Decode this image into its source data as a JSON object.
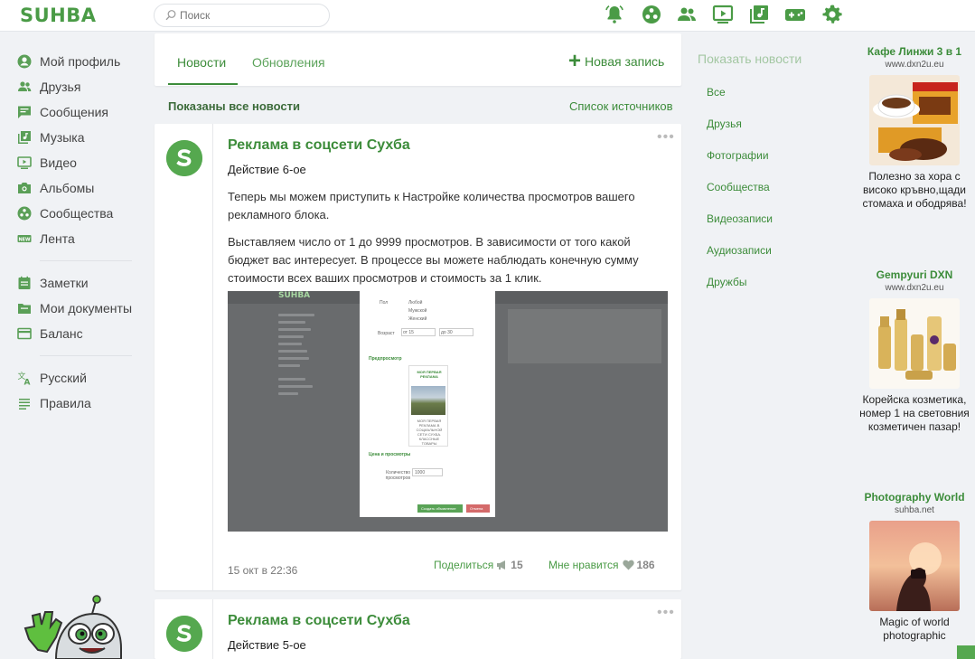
{
  "header": {
    "logo": "SUHBA",
    "search_placeholder": "Поиск",
    "icons": [
      "bell-icon",
      "communities-icon",
      "friends-icon",
      "video-icon",
      "music-icon",
      "games-icon",
      "settings-icon"
    ]
  },
  "sidebar": {
    "items": [
      {
        "label": "Мой профиль",
        "icon": "profile-icon"
      },
      {
        "label": "Друзья",
        "icon": "friends-icon"
      },
      {
        "label": "Сообщения",
        "icon": "messages-icon"
      },
      {
        "label": "Музыка",
        "icon": "music-icon"
      },
      {
        "label": "Видео",
        "icon": "video-icon"
      },
      {
        "label": "Альбомы",
        "icon": "camera-icon"
      },
      {
        "label": "Сообщества",
        "icon": "communities-icon"
      },
      {
        "label": "Лента",
        "icon": "new-badge-icon"
      }
    ],
    "items2": [
      {
        "label": "Заметки",
        "icon": "notes-icon"
      },
      {
        "label": "Мои документы",
        "icon": "documents-icon"
      },
      {
        "label": "Баланс",
        "icon": "card-icon"
      }
    ],
    "items3": [
      {
        "label": "Русский",
        "icon": "language-icon"
      },
      {
        "label": "Правила",
        "icon": "rules-icon"
      }
    ]
  },
  "tabs": {
    "news": "Новости",
    "updates": "Обновления",
    "new_post": "Новая запись"
  },
  "filter": {
    "shown": "Показаны все новости",
    "sources": "Список источников"
  },
  "posts": [
    {
      "title": "Реклама в соцсети Сухба",
      "subtitle": "Действие 6-ое",
      "paragraph1": "Теперь мы можем приступить к Настройке количества просмотров вашего рекламного блока.",
      "paragraph2": "Выставляем число от 1 до 9999 просмотров. В зависимости от того какой бюджет вас интересует. В процессе вы можете наблюдать конечную сумму стоимости всех ваших просмотров и стоимость за 1 клик.",
      "date": "15 окт в 22:36",
      "share_label": "Поделиться",
      "share_count": "15",
      "like_label": "Мне нравится",
      "like_count": "186",
      "image": {
        "logo": "SUHBA",
        "ad_title": "МОЯ ПЕРВАЯ РЕКЛАМА",
        "ad_caption": "МОЯ ПЕРВАЯ РЕКЛАМА В СОЦИАЛЬНОЙ СЕТИ СУХБА. КЛАССНЫЕ ТОВАРЫ",
        "gender_label": "Пол",
        "gender_any": "Любой",
        "gender_male": "Мужской",
        "gender_female": "Женский",
        "age_label": "Возраст",
        "age_from": "от 15",
        "age_to": "до 30",
        "preview_label": "Предпросмотр",
        "price_label": "Цена и просмотры",
        "views_label": "Количество просмотров",
        "views_value": "1000",
        "create_btn": "Создать объявление",
        "cancel_btn": "Отмена"
      }
    },
    {
      "title": "Реклама в соцсети Сухба",
      "subtitle": "Действие 5-ое"
    }
  ],
  "right_menu": {
    "title": "Показать новости",
    "items": [
      "Все",
      "Друзья",
      "Фотографии",
      "Сообщества",
      "Видеозаписи",
      "Аудиозаписи",
      "Дружбы"
    ]
  },
  "ads": [
    {
      "title": "Кафе Линжи 3 в 1",
      "domain": "www.dxn2u.eu",
      "text": "Полезно за хора с високо кръвно,щади стомаха и ободрява!"
    },
    {
      "title": "Gempyuri DXN",
      "domain": "www.dxn2u.eu",
      "text": "Корейска козметика, номер 1 на световния козметичен пазар!"
    },
    {
      "title": "Photography World",
      "domain": "suhba.net",
      "text": "Magic of world photographic"
    }
  ],
  "colors": {
    "brand": "#4a9b46",
    "link": "#3c8c3a",
    "background": "#f0f2f5"
  }
}
